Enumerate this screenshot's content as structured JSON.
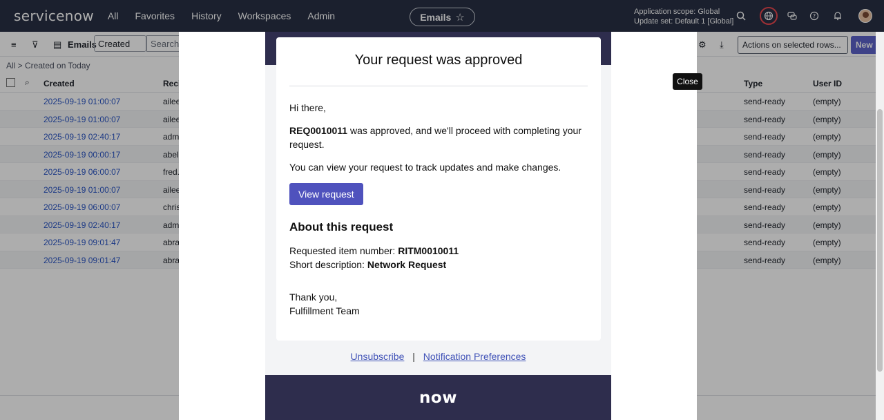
{
  "nav": {
    "logo": "servicenow",
    "items": [
      "All",
      "Favorites",
      "History",
      "Workspaces",
      "Admin"
    ],
    "context_pill": "Emails",
    "scope_line1": "Application scope: Global",
    "scope_line2": "Update set: Default 1 [Global]"
  },
  "list": {
    "title": "Emails",
    "filter_field": "Created",
    "search_placeholder": "Search",
    "actions_select": "Actions on selected rows...",
    "new_button": "New",
    "breadcrumb": "All > Created on Today",
    "columns": {
      "created": "Created",
      "recipient": "Reci",
      "type": "Type",
      "user_id": "User ID"
    },
    "rows": [
      {
        "created": "2025-09-19 01:00:07",
        "recipient": "ailee",
        "type": "send-ready",
        "user_id": "(empty)"
      },
      {
        "created": "2025-09-19 01:00:07",
        "recipient": "ailee",
        "type": "send-ready",
        "user_id": "(empty)"
      },
      {
        "created": "2025-09-19 02:40:17",
        "recipient": "adm",
        "type": "send-ready",
        "user_id": "(empty)"
      },
      {
        "created": "2025-09-19 00:00:17",
        "recipient": "abel.",
        "type": "send-ready",
        "user_id": "(empty)"
      },
      {
        "created": "2025-09-19 06:00:07",
        "recipient": "fred.",
        "type": "send-ready",
        "user_id": "(empty)"
      },
      {
        "created": "2025-09-19 01:00:07",
        "recipient": "ailee",
        "type": "send-ready",
        "user_id": "(empty)"
      },
      {
        "created": "2025-09-19 06:00:07",
        "recipient": "chris",
        "type": "send-ready",
        "user_id": "(empty)"
      },
      {
        "created": "2025-09-19 02:40:17",
        "recipient": "adm",
        "type": "send-ready",
        "user_id": "(empty)"
      },
      {
        "created": "2025-09-19 09:01:47",
        "recipient": "abra",
        "type": "send-ready",
        "user_id": "(empty)"
      },
      {
        "created": "2025-09-19 09:01:47",
        "recipient": "abra",
        "type": "send-ready",
        "user_id": "(empty)"
      }
    ]
  },
  "email": {
    "title": "Your request was approved",
    "greeting": "Hi there,",
    "req_number": "REQ0010011",
    "approved_text": " was approved, and we'll proceed with completing your request.",
    "view_text": "You can view your request to track updates and make changes.",
    "view_button": "View request",
    "about_heading": "About this request",
    "item_label": "Requested item number: ",
    "item_value": "RITM0010011",
    "desc_label": "Short description: ",
    "desc_value": "Network Request",
    "thanks": "Thank you,",
    "team": "Fulfillment Team",
    "unsubscribe": "Unsubscribe",
    "separator": "|",
    "preferences": "Notification Preferences",
    "footer_logo": "now"
  },
  "tooltip": "Close"
}
